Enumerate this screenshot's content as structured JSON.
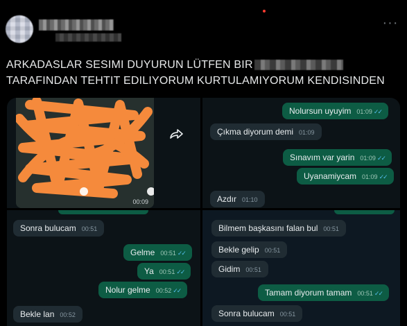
{
  "post": {
    "text_line1": "ARKADASLAR SESIMI DUYURUN LÜTFEN BIR",
    "text_line2": "TARAFINDAN TEHTIT EDILIYORUM KURTULAMIYORUM KENDISINDEN",
    "more_icon": "more-horizontal-icon"
  },
  "screenshots": {
    "top_left": {
      "media_time": "00:09",
      "forward_icon": "forward-arrow-icon"
    },
    "top_right": {
      "messages": [
        {
          "dir": "out",
          "text": "Nolursun uyuyim",
          "time": "01:09",
          "ticks": "✓✓"
        },
        {
          "dir": "in",
          "text": "Çıkma diyorum demi",
          "time": "01:09"
        },
        {
          "dir": "out",
          "text": "Sınavım var yarin",
          "time": "01:09",
          "ticks": "✓✓"
        },
        {
          "dir": "out",
          "text": "Uyanamiycam",
          "time": "01:09",
          "ticks": "✓✓"
        },
        {
          "dir": "in",
          "text": "Azdır",
          "time": "01:10"
        }
      ]
    },
    "bottom_left": {
      "messages": [
        {
          "dir": "in",
          "text": "Sonra bulucam",
          "time": "00:51"
        },
        {
          "dir": "out",
          "text": "Gelme",
          "time": "00:51",
          "ticks": "✓✓"
        },
        {
          "dir": "out",
          "text": "Ya",
          "time": "00:51",
          "ticks": "✓✓"
        },
        {
          "dir": "out",
          "text": "Nolur gelme",
          "time": "00:52",
          "ticks": "✓✓"
        },
        {
          "dir": "in",
          "text": "Bekle lan",
          "time": "00:52"
        }
      ]
    },
    "bottom_right": {
      "messages": [
        {
          "dir": "in",
          "text": "Bilmem başkasını falan bul",
          "time": "00:51"
        },
        {
          "dir": "in",
          "text": "Bekle gelip",
          "time": "00:51"
        },
        {
          "dir": "in",
          "text": "Gidim",
          "time": "00:51"
        },
        {
          "dir": "out",
          "text": "Tamam diyorum tamam",
          "time": "00:51",
          "ticks": "✓✓"
        },
        {
          "dir": "in",
          "text": "Sonra bulucam",
          "time": "00:51"
        }
      ]
    }
  },
  "colors": {
    "incoming_bubble": "#202c33",
    "outgoing_bubble": "#0d5c44",
    "read_ticks": "#53bdeb",
    "scribble": "#f58a3c"
  }
}
